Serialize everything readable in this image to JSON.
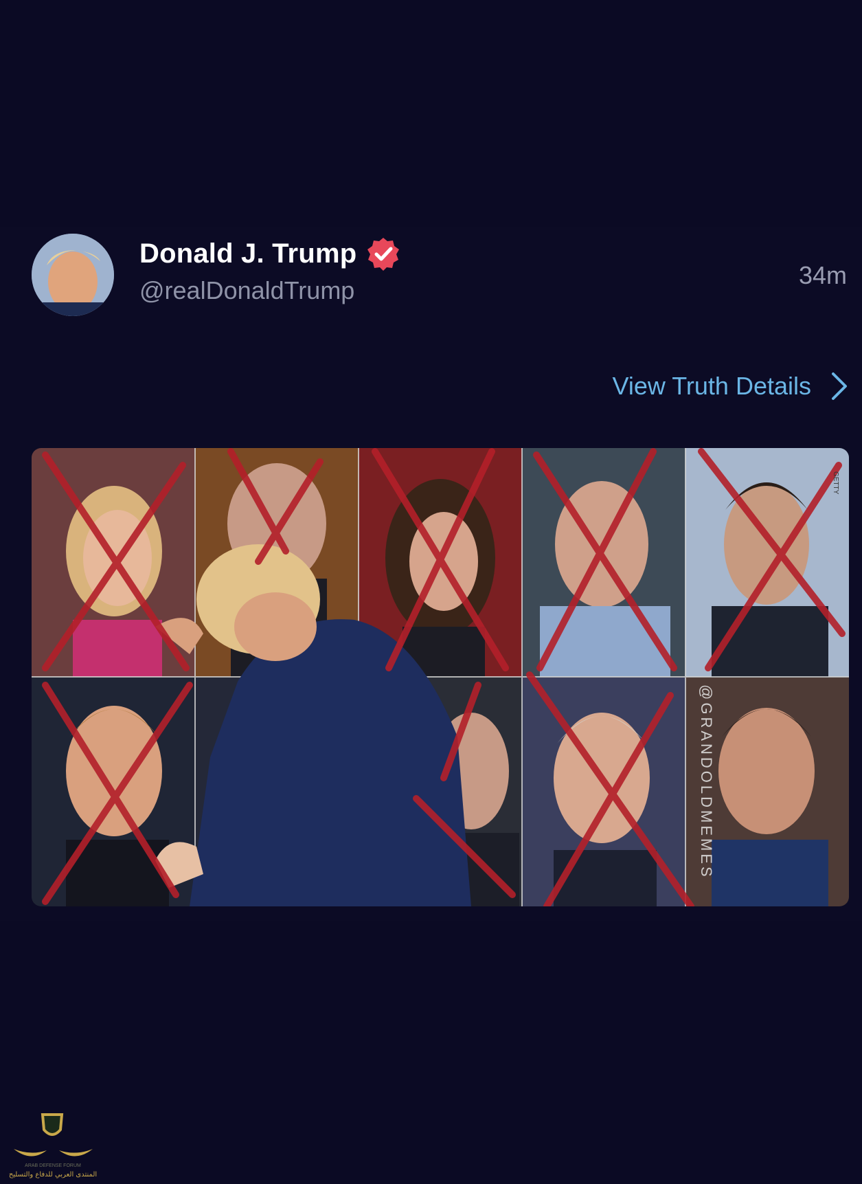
{
  "post": {
    "author": {
      "display_name": "Donald J. Trump",
      "handle": "@realDonaldTrump",
      "verified": true
    },
    "timestamp": "34m",
    "view_details_label": "View Truth Details",
    "media": {
      "watermark_text": "@GRANDOLDMEMES",
      "corner_credit": "GETTY",
      "grid": {
        "rows": 2,
        "columns": 5
      },
      "crossed_out_photos": 8
    }
  },
  "forum_logo": {
    "arabic_text": "المنتدى العربي للدفاع والتسليح",
    "english_text": "ARAB DEFENSE FORUM"
  },
  "colors": {
    "background": "#0b0a24",
    "link": "#6bb6e6",
    "verified_badge": "#e8485a",
    "x_mark": "#b3202a"
  },
  "icons": {
    "verified": "verified-check-icon",
    "details": "chevron-right-icon"
  }
}
